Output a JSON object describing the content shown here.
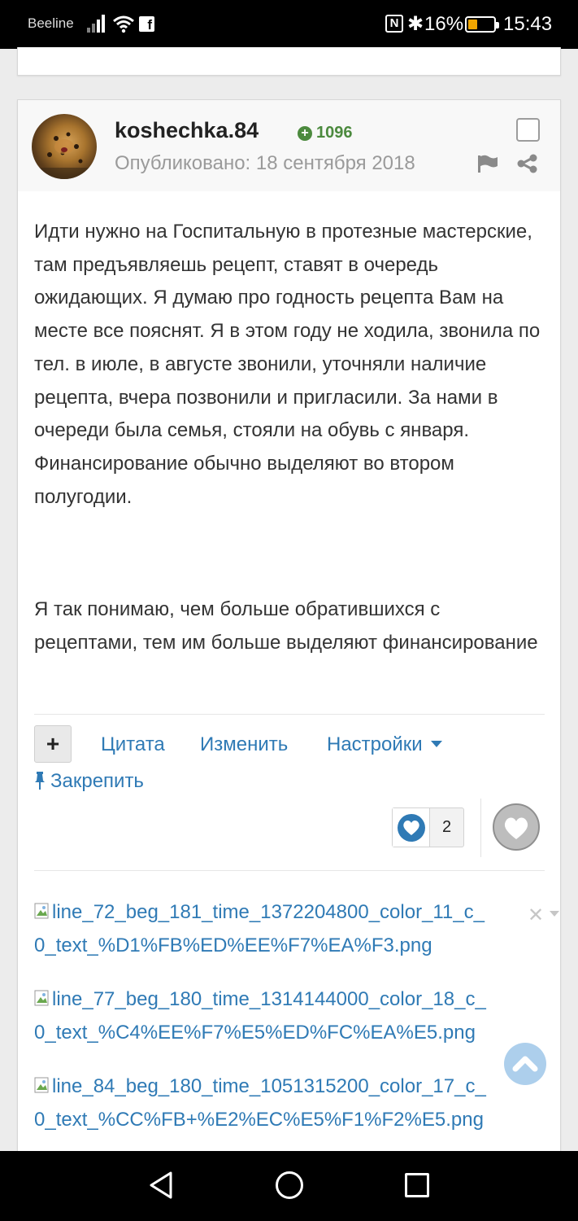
{
  "status_bar": {
    "carrier": "Beeline",
    "battery_percent": "16%",
    "battery_level": 0.16,
    "time": "15:43",
    "icons": [
      "signal-icon",
      "wifi-icon",
      "facebook-icon",
      "nfc-icon",
      "bluetooth-icon",
      "battery-icon"
    ]
  },
  "post": {
    "author": "koshechka.84",
    "reputation": "1096",
    "published": "Опубликовано: 18 сентября 2018",
    "paragraphs": [
      "Идти нужно на Госпитальную в протезные мастерские, там предъявляешь рецепт, ставят в очередь ожидающих. Я думаю про годность рецепта Вам на месте все пояснят. Я в этом году не ходила, звонила по тел. в июле, в августе звонили, уточняли наличие рецепта, вчера позвонили и пригласили. За нами в очереди была семья, стояли на обувь с января. Финансирование обычно выделяют во втором полугодии.",
      "Я так понимаю, чем больше обратившихся с рецептами, тем им больше выделяют финансирование"
    ],
    "actions": {
      "plus": "+",
      "quote": "Цитата",
      "edit": "Изменить",
      "settings": "Настройки",
      "pin": "Закрепить"
    },
    "reactions": {
      "count": "2"
    },
    "attachments": [
      {
        "line1": "line_72_beg_181_time_1372204800_color_11_c_",
        "line2": "0_text_%D1%FB%ED%EE%F7%EA%F3.png"
      },
      {
        "line1": "line_77_beg_180_time_1314144000_color_18_c_",
        "line2": "0_text_%C4%EE%F7%E5%ED%FC%EA%E5.png"
      },
      {
        "line1": "line_84_beg_180_time_1051315200_color_17_c_",
        "line2": "0_text_%CC%FB+%E2%EC%E5%F1%F2%E5.png"
      }
    ]
  },
  "colors": {
    "link": "#2f7ab5",
    "reputation": "#4c8a3e",
    "muted": "#9a9a9a"
  }
}
